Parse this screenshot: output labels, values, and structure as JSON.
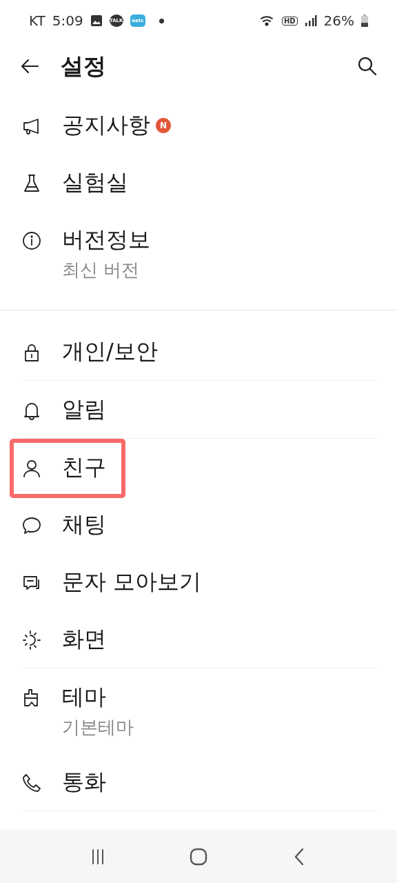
{
  "status_bar": {
    "carrier": "KT",
    "time": "5:09",
    "app_badges": [
      "TALK",
      "eats"
    ],
    "hd": "HD",
    "battery": "26%"
  },
  "header": {
    "title": "설정"
  },
  "sections": [
    {
      "items": [
        {
          "label": "공지사항",
          "badge": "N",
          "divider_after": false,
          "highlighted": false
        },
        {
          "label": "실험실",
          "divider_after": false,
          "highlighted": false
        },
        {
          "label": "버전정보",
          "sublabel": "최신 버전",
          "divider_after": false,
          "highlighted": false
        }
      ]
    },
    {
      "items": [
        {
          "label": "개인/보안",
          "divider_after": true,
          "highlighted": false
        },
        {
          "label": "알림",
          "divider_after": true,
          "highlighted": false
        },
        {
          "label": "친구",
          "divider_after": false,
          "highlighted": true
        },
        {
          "label": "채팅",
          "divider_after": false,
          "highlighted": false
        },
        {
          "label": "문자 모아보기",
          "divider_after": false,
          "highlighted": false
        },
        {
          "label": "화면",
          "divider_after": true,
          "highlighted": false
        },
        {
          "label": "테마",
          "sublabel": "기본테마",
          "divider_after": false,
          "highlighted": false
        },
        {
          "label": "통화",
          "divider_after": true,
          "highlighted": false
        }
      ]
    }
  ]
}
